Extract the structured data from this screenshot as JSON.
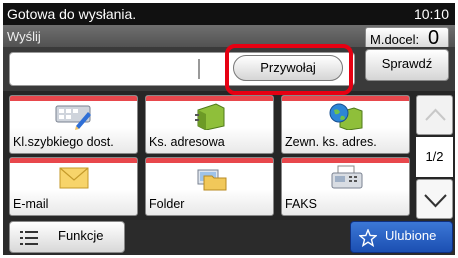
{
  "status": {
    "message": "Gotowa do wysłania.",
    "time": "10:10"
  },
  "header": {
    "title": "Wyślij",
    "mdocel_label": "M.docel:",
    "mdocel_value": "0"
  },
  "destination": {
    "value": ""
  },
  "buttons": {
    "recall": "Przywołaj",
    "check": "Sprawdź",
    "functions": "Funkcje",
    "favorites": "Ulubione"
  },
  "tiles": [
    {
      "label": "Kl.szybkiego dost.",
      "icon": "keyboard-pen-icon"
    },
    {
      "label": "Ks. adresowa",
      "icon": "address-book-icon"
    },
    {
      "label": "Zewn. ks. adres.",
      "icon": "globe-book-icon"
    },
    {
      "label": "E-mail",
      "icon": "envelope-icon"
    },
    {
      "label": "Folder",
      "icon": "folder-icon"
    },
    {
      "label": "FAKS",
      "icon": "fax-icon"
    }
  ],
  "pagination": {
    "current": "1/2"
  },
  "colors": {
    "highlight": "#e60012",
    "tile_stripe": "#e8474c",
    "favorites": "#2a5ec4"
  }
}
